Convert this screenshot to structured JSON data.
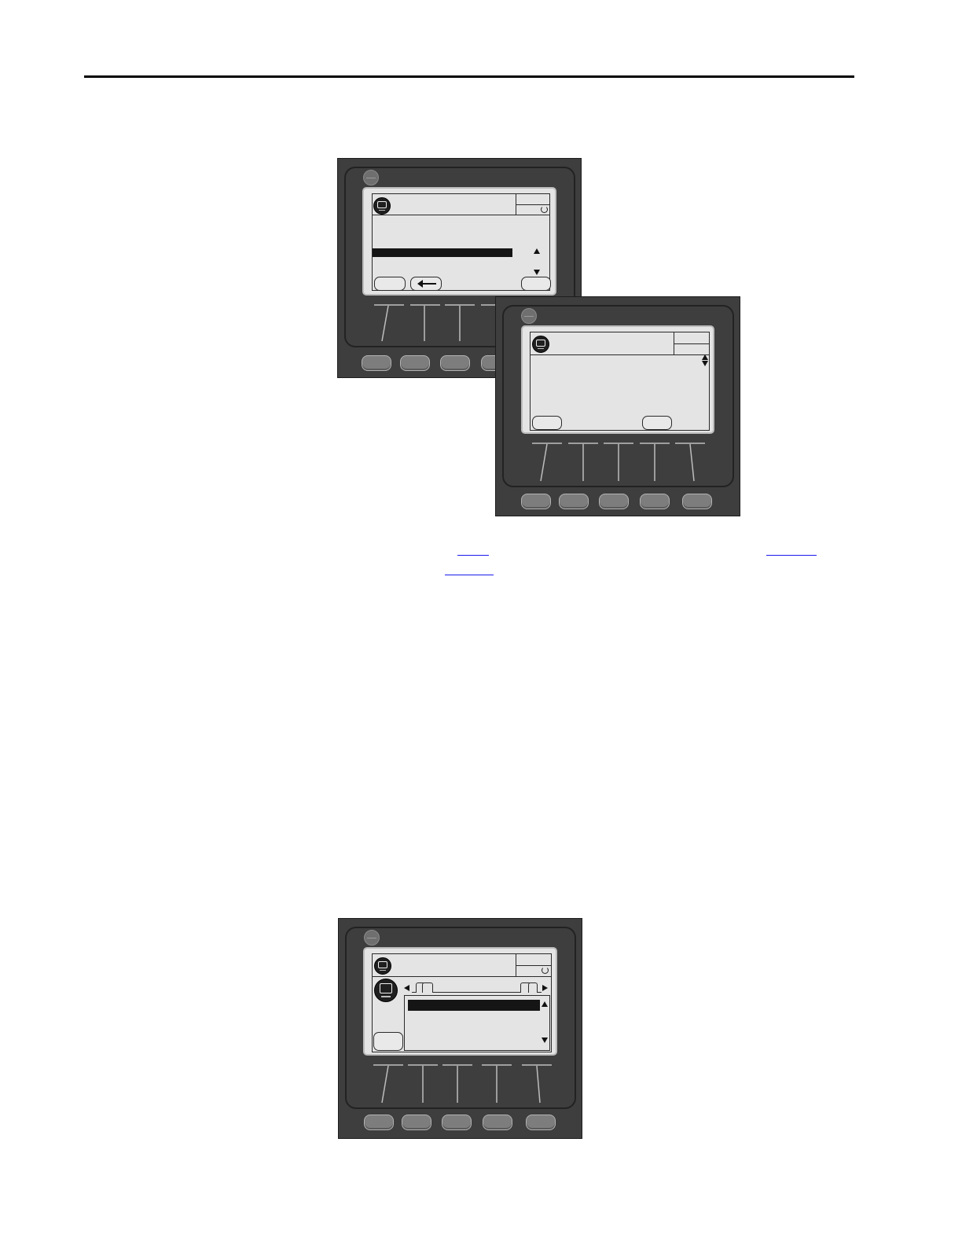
{
  "page": {
    "figures": [
      {
        "id": "keypad-top-left",
        "soft_keys": 5
      },
      {
        "id": "keypad-top-right",
        "soft_keys": 5
      },
      {
        "id": "keypad-bottom",
        "soft_keys": 5
      }
    ],
    "links": [
      "cross-reference-1",
      "cross-reference-2",
      "cross-reference-3"
    ]
  },
  "colors": {
    "bezel": "#3e3e3e",
    "lcd": "#e4e4e4",
    "link": "#1a1aee"
  }
}
